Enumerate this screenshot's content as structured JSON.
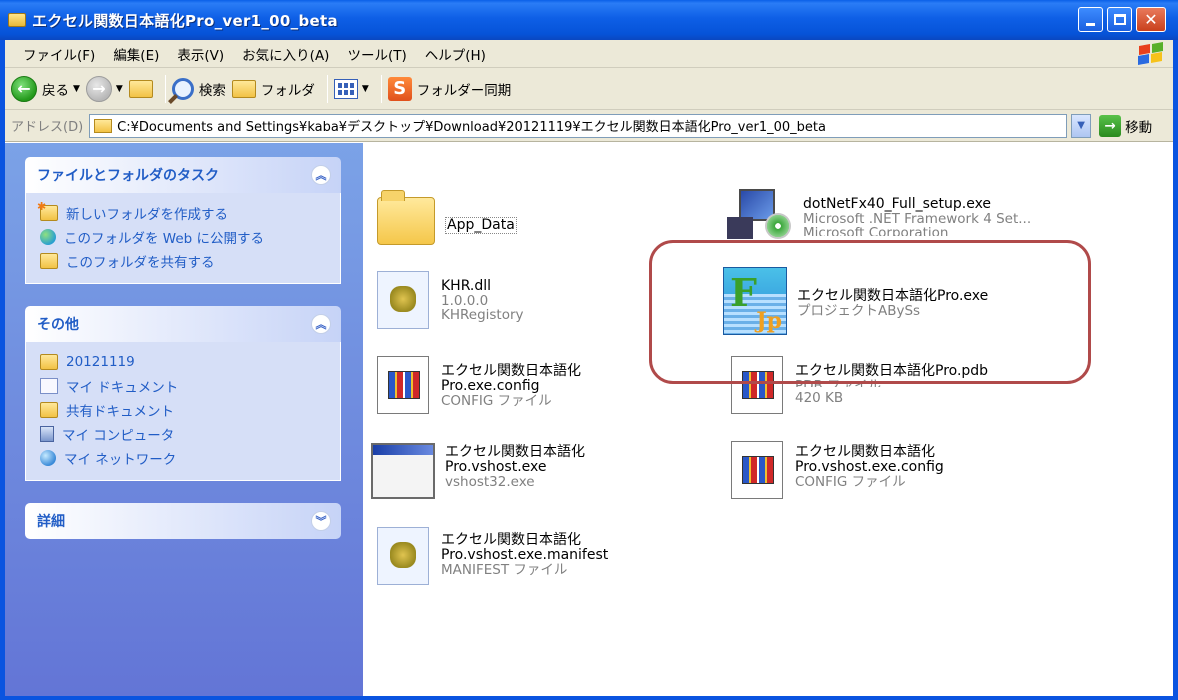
{
  "window": {
    "title": "エクセル関数日本語化Pro_ver1_00_beta"
  },
  "menu": [
    "ファイル(F)",
    "編集(E)",
    "表示(V)",
    "お気に入り(A)",
    "ツール(T)",
    "ヘルプ(H)"
  ],
  "toolbar": {
    "back_label": "戻る",
    "search_label": "検索",
    "folders_label": "フォルダ",
    "sync_label": "フォルダー同期"
  },
  "address": {
    "label": "アドレス(D)",
    "path": "C:¥Documents and Settings¥kaba¥デスクトップ¥Download¥20121119¥エクセル関数日本語化Pro_ver1_00_beta",
    "go_label": "移動"
  },
  "sidebar": {
    "tasks": {
      "title": "ファイルとフォルダのタスク",
      "items": [
        "新しいフォルダを作成する",
        "このフォルダを Web に公開する",
        "このフォルダを共有する"
      ]
    },
    "other": {
      "title": "その他",
      "items": [
        "20121119",
        "マイ ドキュメント",
        "共有ドキュメント",
        "マイ コンピュータ",
        "マイ ネットワーク"
      ]
    },
    "details": {
      "title": "詳細"
    }
  },
  "files": {
    "app_data": {
      "name": "App_Data"
    },
    "dotnet": {
      "name": "dotNetFx40_Full_setup.exe",
      "line2": "Microsoft .NET Framework 4 Set...",
      "line3": "Microsoft Corporation"
    },
    "khr": {
      "name": "KHR.dll",
      "line2": "1.0.0.0",
      "line3": "KHRegistory"
    },
    "pro_exe": {
      "name": "エクセル関数日本語化Pro.exe",
      "line2": "プロジェクトABySs"
    },
    "pro_config": {
      "name": "エクセル関数日本語化",
      "line2": "Pro.exe.config",
      "line3": "CONFIG ファイル"
    },
    "pro_pdb": {
      "name": "エクセル関数日本語化Pro.pdb",
      "line2": "PDB ファイル",
      "line3": "420 KB"
    },
    "vshost_exe": {
      "name": "エクセル関数日本語化",
      "line2": "Pro.vshost.exe",
      "line3": "vshost32.exe"
    },
    "vshost_config": {
      "name": "エクセル関数日本語化",
      "line2": "Pro.vshost.exe.config",
      "line3": "CONFIG ファイル"
    },
    "vshost_manifest": {
      "name": "エクセル関数日本語化",
      "line2": "Pro.vshost.exe.manifest",
      "line3": "MANIFEST ファイル"
    }
  },
  "colors": {
    "titlebar": "#0a54e0",
    "task_title": "#215dc6",
    "highlight": "#b04a4a"
  }
}
